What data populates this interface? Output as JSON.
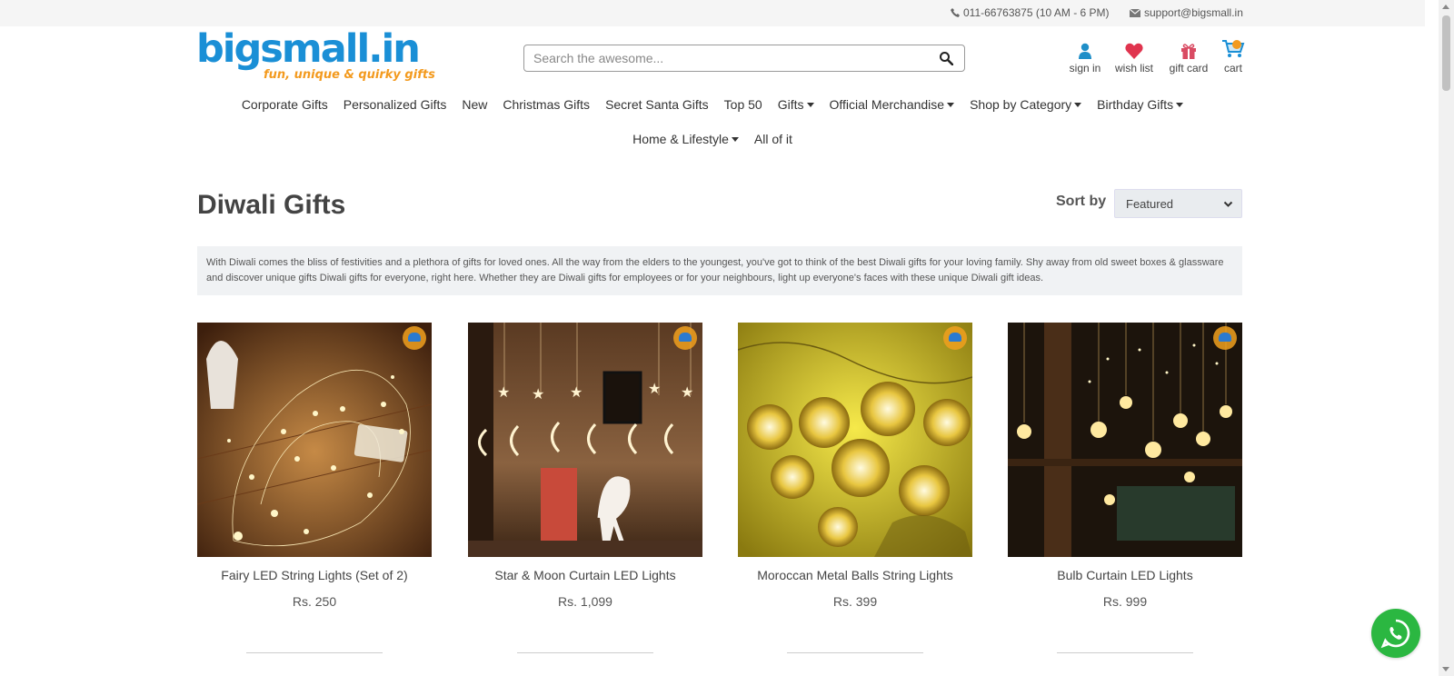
{
  "topbar": {
    "phone": "011-66763875 (10 AM - 6 PM)",
    "email": "support@bigsmall.in"
  },
  "logo": {
    "brand": "bigsmall.in",
    "tagline": "fun, unique & quirky gifts"
  },
  "search": {
    "placeholder": "Search the awesome...",
    "value": "",
    "icon": "search-icon"
  },
  "account": {
    "sign_in": "sign in",
    "wish_list": "wish list",
    "gift_card": "gift card",
    "cart": "cart"
  },
  "nav": {
    "row1": [
      {
        "label": "Corporate Gifts",
        "dropdown": false
      },
      {
        "label": "Personalized Gifts",
        "dropdown": false
      },
      {
        "label": "New",
        "dropdown": false
      },
      {
        "label": "Christmas Gifts",
        "dropdown": false
      },
      {
        "label": "Secret Santa Gifts",
        "dropdown": false
      },
      {
        "label": "Top 50",
        "dropdown": false
      },
      {
        "label": "Gifts",
        "dropdown": true
      },
      {
        "label": "Official Merchandise",
        "dropdown": true
      },
      {
        "label": "Shop by Category",
        "dropdown": true
      },
      {
        "label": "Birthday Gifts",
        "dropdown": true
      }
    ],
    "row2": [
      {
        "label": "Home & Lifestyle",
        "dropdown": true
      },
      {
        "label": "All of it",
        "dropdown": false
      }
    ]
  },
  "page": {
    "title": "Diwali Gifts",
    "sort_label": "Sort by",
    "sort_value": "Featured",
    "description": "With Diwali comes the bliss of festivities and a plethora of gifts for loved ones. All the way from the elders to the youngest, you've got to think of the best Diwali gifts for your loving family. Shy away from old sweet boxes & glassware and discover unique gifts Diwali gifts for everyone, right here. Whether they are Diwali gifts for employees or for your neighbours, light up everyone's faces with these unique Diwali gift ideas."
  },
  "products": [
    {
      "name": "Fairy LED String Lights (Set of 2)",
      "price": "Rs. 250"
    },
    {
      "name": "Star & Moon Curtain LED Lights",
      "price": "Rs. 1,099"
    },
    {
      "name": "Moroccan Metal Balls String Lights",
      "price": "Rs. 399"
    },
    {
      "name": "Bulb Curtain LED Lights",
      "price": "Rs. 999"
    }
  ],
  "colors": {
    "brand_blue": "#1a8fd6",
    "brand_orange": "#f39a1e",
    "whatsapp_green": "#2bb741",
    "heart_red": "#e0344e"
  }
}
